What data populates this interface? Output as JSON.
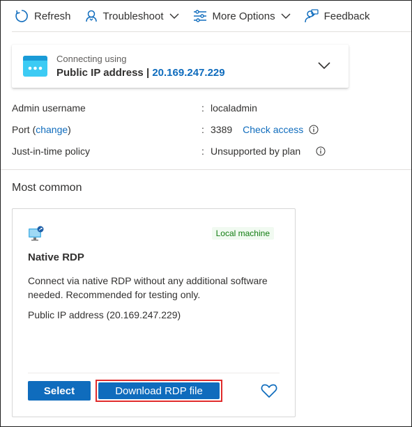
{
  "toolbar": {
    "refresh": "Refresh",
    "troubleshoot": "Troubleshoot",
    "more_options": "More Options",
    "feedback": "Feedback"
  },
  "connection": {
    "subtitle": "Connecting using",
    "type": "Public IP address",
    "separator": " | ",
    "ip": "20.169.247.229"
  },
  "properties": {
    "admin_label": "Admin username",
    "admin_value": "localadmin",
    "port_label_prefix": "Port (",
    "port_change": "change",
    "port_label_suffix": ")",
    "port_value": "3389",
    "check_access": "Check access",
    "jit_label": "Just-in-time policy",
    "jit_value": "Unsupported by plan",
    "colon": ":"
  },
  "section_title": "Most common",
  "rdp_card": {
    "badge": "Local machine",
    "title": "Native RDP",
    "description": "Connect via native RDP without any additional software needed. Recommended for testing only.",
    "ip_line": "Public IP address (20.169.247.229)",
    "select_label": "Select",
    "download_label": "Download RDP file"
  },
  "colors": {
    "accent": "#0f6cbd",
    "badge_green": "#107c10",
    "highlight_red": "#e02b2b"
  },
  "icons": [
    "refresh-icon",
    "troubleshoot-icon",
    "chevron-down-icon",
    "options-icon",
    "feedback-icon",
    "vm-icon",
    "info-icon",
    "monitor-icon",
    "heart-icon"
  ]
}
